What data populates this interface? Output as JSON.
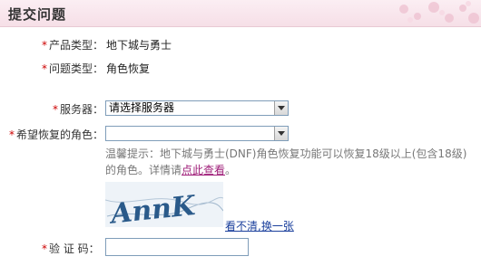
{
  "header": {
    "title": "提交问题"
  },
  "form": {
    "product_type": {
      "label": "产品类型：",
      "value": "地下城与勇士"
    },
    "issue_type": {
      "label": "问题类型：",
      "value": "角色恢复"
    },
    "server": {
      "label": "服务器：",
      "selected": "请选择服务器"
    },
    "role": {
      "label": "希望恢复的角色：",
      "selected": ""
    },
    "tip": {
      "text": "温馨提示：地下城与勇士(DNF)角色恢复功能可以恢复18级以上(包含18级)的角色。详情请",
      "link": "点此查看",
      "tail": "。"
    },
    "captcha": {
      "text": "AnnK",
      "refresh_link": "看不清,换一张"
    },
    "verify": {
      "label": "验 证 码：",
      "value": ""
    }
  },
  "colors": {
    "required_star": "#cc0000",
    "header_bg": "#f6dfe7",
    "tip_link": "#a0207a",
    "refresh_link": "#1a3f9c",
    "captcha_ink": "#2a5a8a"
  }
}
